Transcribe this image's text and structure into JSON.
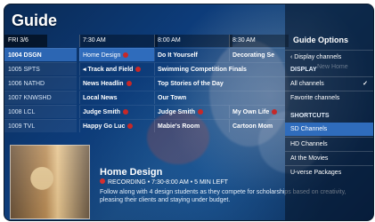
{
  "title": "Guide",
  "grid": {
    "date": "FRI 3/6",
    "times": [
      "7:30 AM",
      "8:00 AM",
      "8:30 AM"
    ],
    "channels": [
      {
        "label": "1004 DSGN",
        "selected": true
      },
      {
        "label": "1005 SPTS",
        "selected": false
      },
      {
        "label": "1006 NATHD",
        "selected": false
      },
      {
        "label": "1007 KNWSHD",
        "selected": false
      },
      {
        "label": "1008 LCL",
        "selected": false
      },
      {
        "label": "1009 TVL",
        "selected": false
      }
    ],
    "rows": [
      [
        {
          "text": "Home Design",
          "rec": true,
          "sel": true
        },
        {
          "text": "Do It Yourself",
          "rec": false,
          "sel": false
        },
        {
          "text": "Decorating Se",
          "rec": false,
          "sel": false
        }
      ],
      [
        {
          "text": "◂ Track and Field",
          "rec": true,
          "sel": false
        },
        {
          "text": "Swimming Competition Finals",
          "rec": false,
          "sel": false
        }
      ],
      [
        {
          "text": "News Headlin",
          "rec": true,
          "sel": false
        },
        {
          "text": "Top Stories of the Day",
          "rec": false,
          "sel": false
        }
      ],
      [
        {
          "text": "Local News",
          "rec": false,
          "sel": false
        },
        {
          "text": "Our Town",
          "rec": false,
          "sel": false
        }
      ],
      [
        {
          "text": "Judge Smith",
          "rec": true,
          "sel": false
        },
        {
          "text": "Judge Smith",
          "rec": true,
          "sel": false
        },
        {
          "text": "My Own Life",
          "rec": true,
          "sel": false
        }
      ],
      [
        {
          "text": "Happy Go Luc",
          "rec": true,
          "sel": false
        },
        {
          "text": "Mabie's Room",
          "rec": false,
          "sel": false
        },
        {
          "text": "Cartoon Mom",
          "rec": false,
          "sel": false
        }
      ]
    ]
  },
  "info": {
    "title": "Home Design",
    "rec_label": "RECORDING",
    "time": "7:30-8:00 AM",
    "left": "5 MIN LEFT",
    "desc": "Follow along with 4 design students as they compete for scholarships based on creativity, pleasing their clients and staying under budget."
  },
  "options": {
    "title": "Guide Options",
    "back": "Display channels",
    "display_header": "DISPLAY",
    "display_ghost": "New Home",
    "items": [
      {
        "label": "All channels",
        "checked": true
      },
      {
        "label": "Favorite channels",
        "checked": false
      }
    ],
    "shortcuts_header": "SHORTCUTS",
    "shortcuts": [
      {
        "label": "SD Channels",
        "selected": true
      },
      {
        "label": "HD Channels",
        "selected": false
      },
      {
        "label": "At the Movies",
        "selected": false
      },
      {
        "label": "U-verse Packages",
        "selected": false
      }
    ]
  }
}
